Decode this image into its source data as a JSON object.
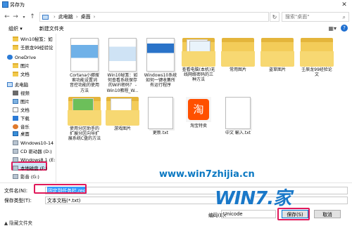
{
  "window": {
    "title": "另存为"
  },
  "address": {
    "crumbs": [
      "此电脑",
      "桌面"
    ],
    "search_placeholder": "搜索\"桌面\""
  },
  "commands": {
    "organize": "组织 ▾",
    "new_folder": "新建文件夹"
  },
  "nav": {
    "items": [
      {
        "label": "Win10秘笈：如",
        "icon": "folder-icon"
      },
      {
        "label": "壬辰龙99经验论",
        "icon": "folder-icon"
      },
      {
        "label": "OneDrive",
        "icon": "onedrive-icon"
      },
      {
        "label": "图片",
        "icon": "folder-icon"
      },
      {
        "label": "文档",
        "icon": "folder-icon"
      },
      {
        "label": "此电脑",
        "icon": "pc-icon"
      },
      {
        "label": "视频",
        "icon": "video-icon"
      },
      {
        "label": "图片",
        "icon": "pictures-icon"
      },
      {
        "label": "文档",
        "icon": "documents-icon"
      },
      {
        "label": "下载",
        "icon": "download-icon"
      },
      {
        "label": "音乐",
        "icon": "music-icon"
      },
      {
        "label": "桌面",
        "icon": "desktop-icon"
      },
      {
        "label": "Windows10-14",
        "icon": "drive-icon"
      },
      {
        "label": "CD 驱动器 (D:)",
        "icon": "cd-drive-icon"
      },
      {
        "label": "Windows8.1 (E:",
        "icon": "drive-icon"
      },
      {
        "label": "本地磁盘 (F:)",
        "icon": "drive-icon"
      },
      {
        "label": "影音 (G:)",
        "icon": "drive-icon"
      },
      {
        "label": "文档 (H:)",
        "icon": "drive-icon"
      }
    ]
  },
  "files": [
    {
      "label": "Cortana小娜搜\n索功能设置词\n音控功能的使用\n方法",
      "kind": "doc"
    },
    {
      "label": "Win10秘笈：如\n何查看系统保存\n的WiFi密码？ -\nWin10教程_W...",
      "kind": "doc"
    },
    {
      "label": "Windows10系统\n如何一键收集所\n有运行程序",
      "kind": "doc"
    },
    {
      "label": "查看电脑(本机)无\n线网络密码的三\n种方法",
      "kind": "folder"
    },
    {
      "label": "常用图片",
      "kind": "folder"
    },
    {
      "label": "盗草图片",
      "kind": "folder"
    },
    {
      "label": "壬辰龙99经验论\n文",
      "kind": "folder"
    },
    {
      "label": "使用分区助手的\n扩展分区向导扩\n展系统C盘的方法",
      "kind": "folder"
    },
    {
      "label": "游戏图片",
      "kind": "folder"
    },
    {
      "label": "更新.txt",
      "kind": "txt"
    },
    {
      "label": "淘宝特卖",
      "kind": "taobao"
    },
    {
      "label": "中文 輸入.txt",
      "kind": "txt"
    }
  ],
  "taobao_glyph": "淘",
  "form": {
    "filename_label": "文件名(N):",
    "filename_value": "固定到任务栏.reg",
    "filetype_label": "保存类型(T):",
    "filetype_value": "文本文档(*.txt)",
    "encoding_label": "编码(E):",
    "encoding_value": "Unicode",
    "save_label": "保存(S)",
    "cancel_label": "取消",
    "hide_folders": "▲ 隐藏文件夹"
  },
  "watermark": {
    "url": "www.win7zhijia.cn",
    "logo": "WIN7.家"
  },
  "colors": {
    "highlight": "#e0195a",
    "selection": "#cde6f7",
    "accent": "#0078d7"
  }
}
